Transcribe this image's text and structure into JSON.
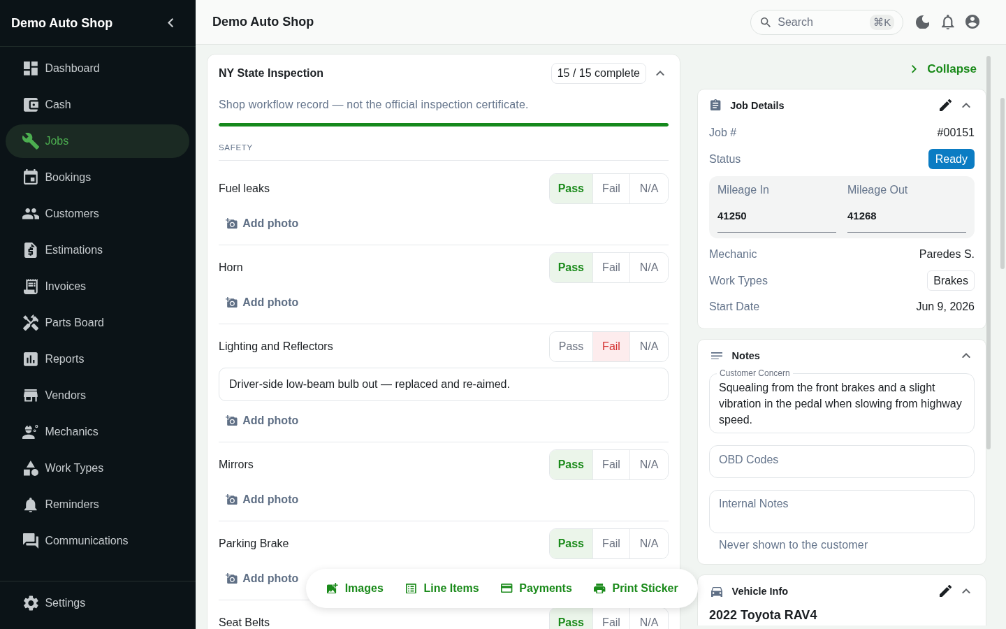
{
  "sidebar": {
    "title": "Demo Auto Shop",
    "items": [
      {
        "label": "Dashboard",
        "selected": false
      },
      {
        "label": "Cash",
        "selected": false
      },
      {
        "label": "Jobs",
        "selected": true
      },
      {
        "label": "Bookings",
        "selected": false
      },
      {
        "label": "Customers",
        "selected": false
      },
      {
        "label": "Estimations",
        "selected": false
      },
      {
        "label": "Invoices",
        "selected": false
      },
      {
        "label": "Parts Board",
        "selected": false
      },
      {
        "label": "Reports",
        "selected": false
      },
      {
        "label": "Vendors",
        "selected": false
      },
      {
        "label": "Mechanics",
        "selected": false
      },
      {
        "label": "Work Types",
        "selected": false
      },
      {
        "label": "Reminders",
        "selected": false
      },
      {
        "label": "Communications",
        "selected": false
      }
    ],
    "footer_items": [
      {
        "label": "Settings",
        "selected": false
      }
    ]
  },
  "header": {
    "title": "Demo Auto Shop",
    "search": {
      "placeholder": "Search",
      "shortcut": "⌘K"
    }
  },
  "inspection": {
    "title": "NY State Inspection",
    "progress": "15 / 15 complete",
    "expanded": true,
    "disclaimer": "Shop workflow record — not the official inspection certificate.",
    "level": 1,
    "sections": [
      {
        "heading": "SAFETY",
        "items": [
          {
            "name": "Fuel leaks",
            "options": [
              {
                "label": "Pass",
                "selected": true
              },
              {
                "label": "Fail",
                "selected": false
              },
              {
                "label": "N/A",
                "selected": false
              }
            ],
            "add_photo": "Add photo"
          },
          {
            "name": "Horn",
            "options": [
              {
                "label": "Pass",
                "selected": true
              },
              {
                "label": "Fail",
                "selected": false
              },
              {
                "label": "N/A",
                "selected": false
              }
            ],
            "add_photo": "Add photo"
          },
          {
            "name": "Lighting and Reflectors",
            "options": [
              {
                "label": "Pass",
                "selected": false
              },
              {
                "label": "Fail",
                "selected": true
              },
              {
                "label": "N/A",
                "selected": false
              }
            ],
            "note": "Driver-side low-beam bulb out — replaced and re-aimed.",
            "add_photo": "Add photo"
          },
          {
            "name": "Mirrors",
            "options": [
              {
                "label": "Pass",
                "selected": true
              },
              {
                "label": "Fail",
                "selected": false
              },
              {
                "label": "N/A",
                "selected": false
              }
            ],
            "add_photo": "Add photo"
          },
          {
            "name": "Parking Brake",
            "options": [
              {
                "label": "Pass",
                "selected": true
              },
              {
                "label": "Fail",
                "selected": false
              },
              {
                "label": "N/A",
                "selected": false
              }
            ],
            "add_photo": "Add photo"
          },
          {
            "name": "Seat Belts",
            "options": [
              {
                "label": "Pass",
                "selected": true
              },
              {
                "label": "Fail",
                "selected": false
              },
              {
                "label": "N/A",
                "selected": false
              }
            ]
          }
        ]
      }
    ]
  },
  "toolbar": [
    {
      "label": "Images"
    },
    {
      "label": "Line Items"
    },
    {
      "label": "Payments"
    },
    {
      "label": "Print Sticker"
    }
  ],
  "side_panel": {
    "collapse": "Collapse",
    "job_details": {
      "title": "Job Details",
      "expanded": true,
      "rows": [
        {
          "kind": "text",
          "label": "Job #",
          "value": "#00151"
        },
        {
          "kind": "badge",
          "label": "Status",
          "value": "Ready"
        },
        {
          "kind": "mileage",
          "fields": [
            {
              "label": "Mileage In",
              "value": "41250"
            },
            {
              "label": "Mileage Out",
              "value": "41268"
            }
          ]
        },
        {
          "kind": "text",
          "label": "Mechanic",
          "value": "Paredes S."
        },
        {
          "kind": "chips",
          "label": "Work Types",
          "chips": [
            "Brakes"
          ]
        },
        {
          "kind": "text",
          "label": "Start Date",
          "value": "Jun 9, 2026"
        }
      ]
    },
    "notes": {
      "title": "Notes",
      "expanded": true,
      "fields": [
        {
          "kind": "textarea",
          "label": "Customer Concern",
          "value": "Squealing from the front brakes and a slight vibration in the pedal when slowing from highway speed."
        },
        {
          "kind": "input",
          "placeholder": "OBD Codes"
        },
        {
          "kind": "textarea",
          "placeholder": "Internal Notes",
          "hint": "Never shown to the customer"
        }
      ]
    },
    "vehicle_info": {
      "title": "Vehicle Info",
      "expanded": true,
      "vehicle": "2022 Toyota RAV4"
    }
  }
}
